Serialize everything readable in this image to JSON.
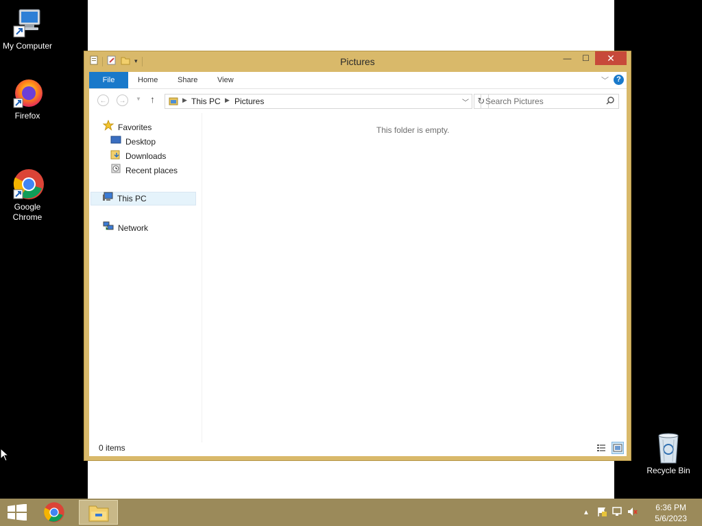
{
  "desktop": {
    "icons": [
      {
        "label": "My Computer"
      },
      {
        "label": "Firefox"
      },
      {
        "label": "Google\nChrome"
      },
      {
        "label": "Recycle Bin"
      }
    ]
  },
  "window": {
    "title": "Pictures",
    "tabs": {
      "file": "File",
      "home": "Home",
      "share": "Share",
      "view": "View"
    },
    "help": "?",
    "address": {
      "crumbs": [
        "This PC",
        "Pictures"
      ]
    },
    "search": {
      "placeholder": "Search Pictures"
    },
    "nav": {
      "favorites": "Favorites",
      "desktop": "Desktop",
      "downloads": "Downloads",
      "recent": "Recent places",
      "thispc": "This PC",
      "network": "Network"
    },
    "empty_message": "This folder is empty.",
    "status": {
      "count": "0 items"
    }
  },
  "taskbar": {
    "time": "6:36 PM",
    "date": "5/6/2023"
  },
  "colors": {
    "accent": "#1979ca",
    "window_frame": "#d9b96a",
    "taskbar": "#9b8a5a",
    "close": "#c7493a"
  }
}
